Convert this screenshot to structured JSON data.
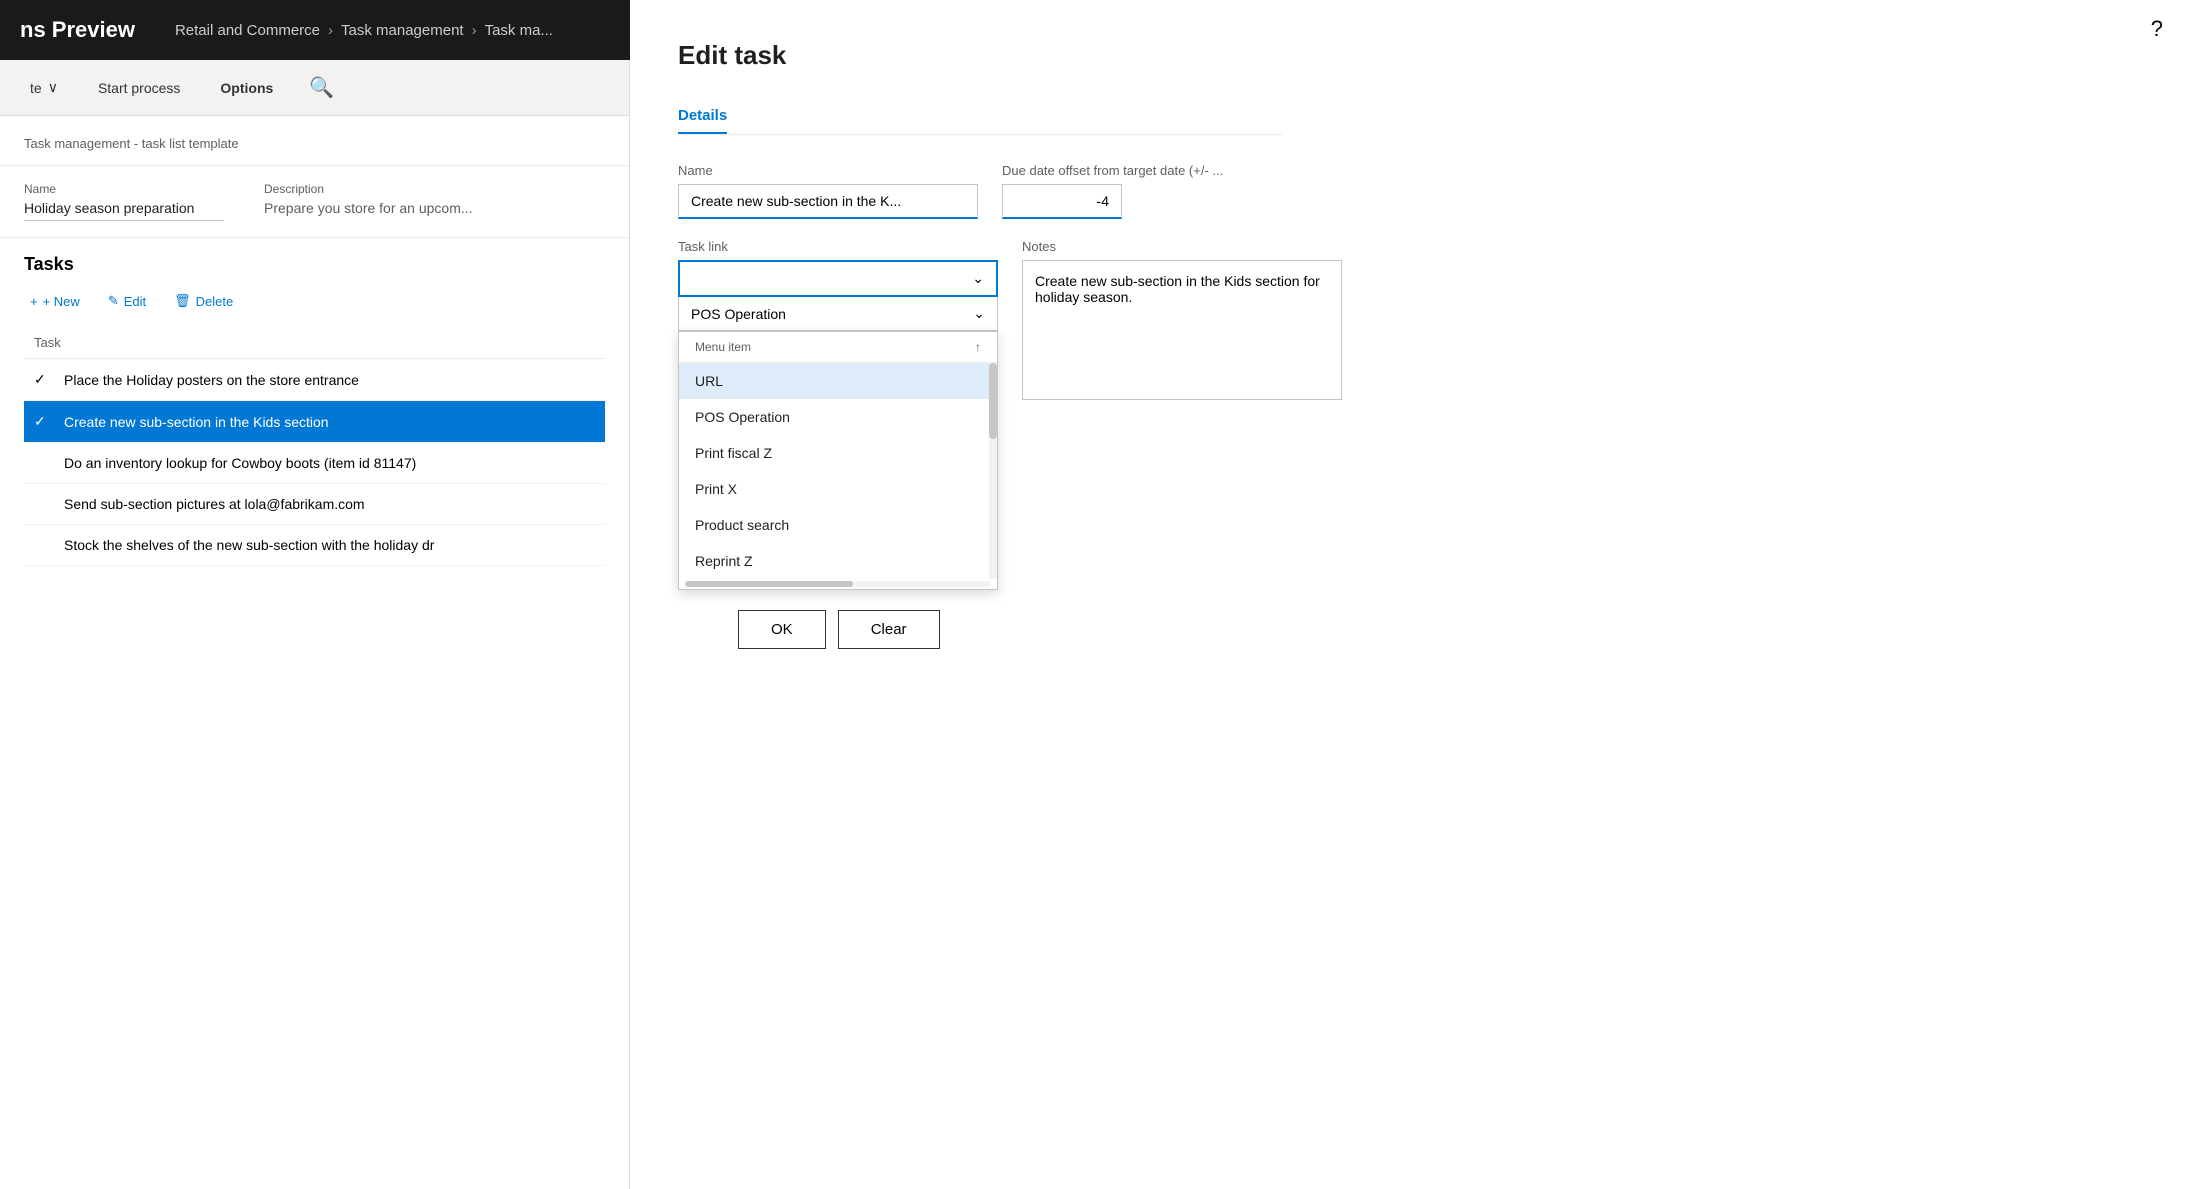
{
  "topNav": {
    "appTitle": "ns Preview",
    "breadcrumb": [
      "Retail and Commerce",
      "Task management",
      "Task ma..."
    ],
    "helpIcon": "?"
  },
  "toolbar": {
    "backLabel": "te",
    "startProcessLabel": "Start process",
    "optionsLabel": "Options",
    "searchIcon": "🔍"
  },
  "pageHeader": {
    "subtitle": "Task management - task list template"
  },
  "meta": {
    "nameLabel": "Name",
    "nameValue": "Holiday season preparation",
    "descLabel": "Description",
    "descValue": "Prepare you store for an upcom..."
  },
  "tasksSection": {
    "title": "Tasks",
    "newLabel": "+ New",
    "editLabel": "Edit",
    "deleteLabel": "Delete",
    "columnHeader": "Task",
    "tasks": [
      {
        "id": 1,
        "label": "Place the Holiday posters on the store entrance",
        "selected": false,
        "checked": false
      },
      {
        "id": 2,
        "label": "Create new sub-section in the Kids section",
        "selected": true,
        "checked": true
      },
      {
        "id": 3,
        "label": "Do an inventory lookup for Cowboy boots (item id 81147)",
        "selected": false,
        "checked": false
      },
      {
        "id": 4,
        "label": "Send sub-section pictures at lola@fabrikam.com",
        "selected": false,
        "checked": false
      },
      {
        "id": 5,
        "label": "Stock the shelves of the new sub-section with the holiday dr",
        "selected": false,
        "checked": false
      }
    ]
  },
  "editTask": {
    "title": "Edit task",
    "tabs": [
      "Details"
    ],
    "activeTab": "Details",
    "nameLabel": "Name",
    "nameValue": "Create new sub-section in the K...",
    "dueDateLabel": "Due date offset from target date (+/- ...",
    "dueDateValue": "-4",
    "taskLinkLabel": "Task link",
    "taskLinkValue": "",
    "notesLabel": "Notes",
    "notesValue": "Create new sub-section in the Kids section for holiday season.",
    "posDropdownLabel": "POS Operation",
    "dropdown": {
      "subheaderLabel": "Menu item",
      "sortIcon": "↑",
      "items": [
        {
          "label": "URL",
          "highlighted": true
        },
        {
          "label": "POS Operation",
          "highlighted": false
        },
        {
          "label": "Print fiscal Z",
          "highlighted": false
        },
        {
          "label": "Print X",
          "highlighted": false
        },
        {
          "label": "Product search",
          "highlighted": false
        },
        {
          "label": "Reprint Z",
          "highlighted": false
        }
      ]
    },
    "okLabel": "OK",
    "clearLabel": "Clear"
  }
}
